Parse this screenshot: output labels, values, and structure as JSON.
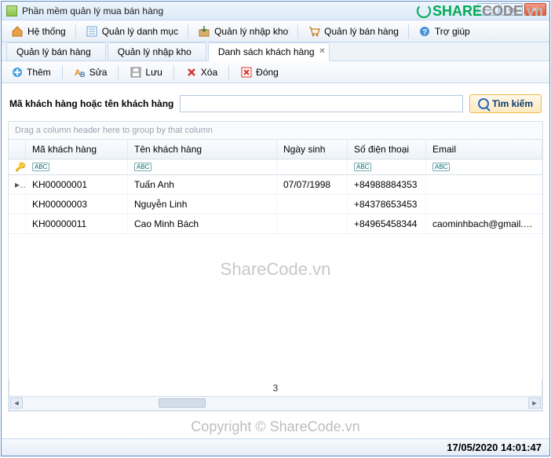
{
  "window": {
    "title": "Phần mềm quản lý mua bán hàng"
  },
  "mainmenu": {
    "items": [
      {
        "label": "Hệ thống",
        "icon": "home-icon"
      },
      {
        "label": "Quản lý danh mục",
        "icon": "list-icon"
      },
      {
        "label": "Quản lý nhập kho",
        "icon": "box-in-icon"
      },
      {
        "label": "Quản lý bán hàng",
        "icon": "cart-icon"
      },
      {
        "label": "Trợ giúp",
        "icon": "help-icon"
      }
    ]
  },
  "tabs": {
    "items": [
      {
        "label": "Quản lý bán hàng",
        "active": false
      },
      {
        "label": "Quản lý nhập kho",
        "active": false
      },
      {
        "label": "Danh sách khách hàng",
        "active": true
      }
    ]
  },
  "toolbar": {
    "add": "Thêm",
    "edit": "Sửa",
    "save": "Lưu",
    "delete": "Xóa",
    "close": "Đóng"
  },
  "search": {
    "label": "Mã khách hàng hoặc tên khách hàng",
    "value": "",
    "button": "Tìm kiếm"
  },
  "grid": {
    "group_hint": "Drag a column header here to group by that column",
    "columns": [
      "Mã khách hàng",
      "Tên khách hàng",
      "Ngày sinh",
      "Số điện thoại",
      "Email"
    ],
    "filter_chip": "ABC",
    "rows": [
      {
        "ma": "KH00000001",
        "ten": "Tuấn Anh",
        "ngay": "07/07/1998",
        "sdt": "+84988884353",
        "email": ""
      },
      {
        "ma": "KH00000003",
        "ten": "Nguyễn Linh",
        "ngay": "",
        "sdt": "+84378653453",
        "email": ""
      },
      {
        "ma": "KH00000011",
        "ten": "Cao Minh Bách",
        "ngay": "",
        "sdt": "+84965458344",
        "email": "caominhbach@gmail.com"
      }
    ],
    "count": "3"
  },
  "status": {
    "datetime": "17/05/2020 14:01:47"
  },
  "watermarks": {
    "top_brand_a": "SHARE",
    "top_brand_b": "CODE",
    "top_brand_c": ".vn",
    "center": "ShareCode.vn",
    "bottom": "Copyright © ShareCode.vn"
  }
}
